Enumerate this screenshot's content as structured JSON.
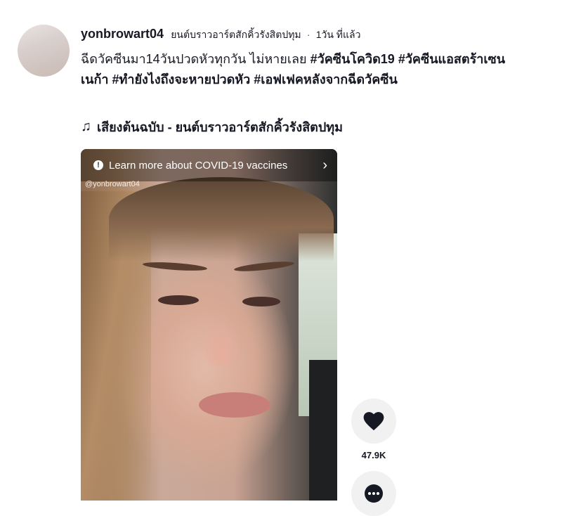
{
  "post": {
    "username": "yonbrowart04",
    "nickname": "ยนต์บราวอาร์ตสักคิ้วรังสิตปทุม",
    "separator": "·",
    "time": "1วัน ที่แล้ว",
    "caption_text": "ฉีดวัคซีนมา14วันปวดหัวทุกวัน ไม่หายเลย ",
    "hashtags": [
      "#วัคซีนโควิด19",
      "#วัคซีนแอสตร้าเซนเนก้า",
      "#ทำยังไงถึงจะหายปวดหัว",
      "#เอฟเฟคหลังจากฉีดวัคซีน"
    ],
    "music_icon": "♫",
    "music": "เสียงต้นฉบับ - ยนต์บราวอาร์ตสักคิ้วรังสิตปทุม"
  },
  "video": {
    "banner_text": "Learn more about COVID-19 vaccines",
    "banner_info_icon": "!",
    "banner_chevron": "›",
    "watermark": "@yonbrowart04"
  },
  "actions": {
    "like_count": "47.9K"
  }
}
